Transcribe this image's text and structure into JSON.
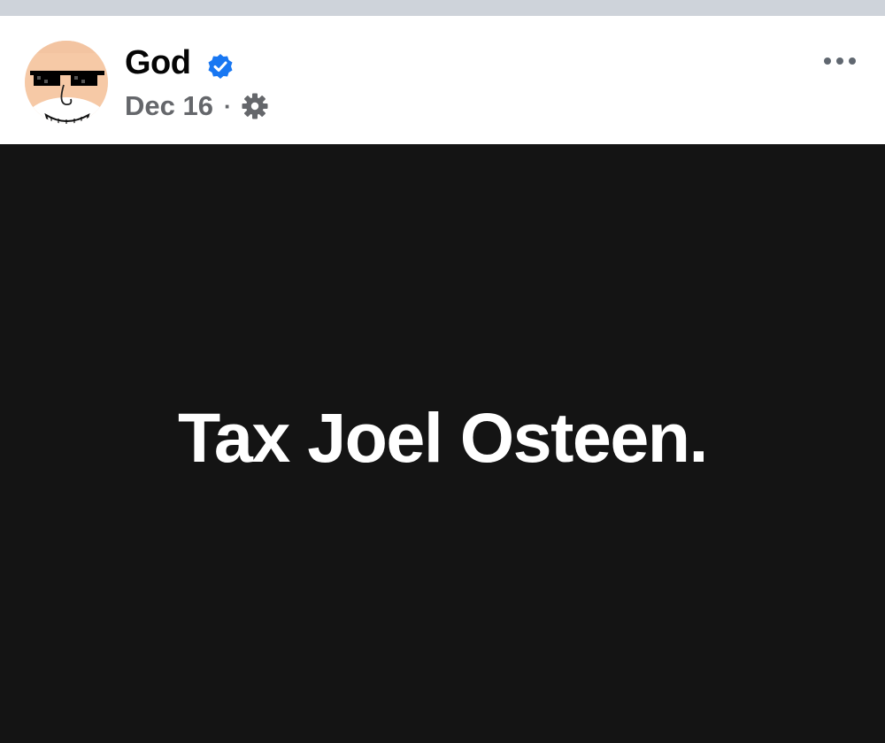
{
  "post": {
    "author": "God",
    "date": "Dec 16",
    "separator": "·",
    "text": "Tax Joel Osteen.",
    "background_color": "#141414",
    "text_color": "#ffffff"
  },
  "icons": {
    "verified": "verified-badge-icon",
    "audience": "gear-icon",
    "more": "more-options-icon"
  },
  "colors": {
    "verified_blue": "#1877f2",
    "meta_gray": "#65676b",
    "top_strip": "#ced3da"
  }
}
